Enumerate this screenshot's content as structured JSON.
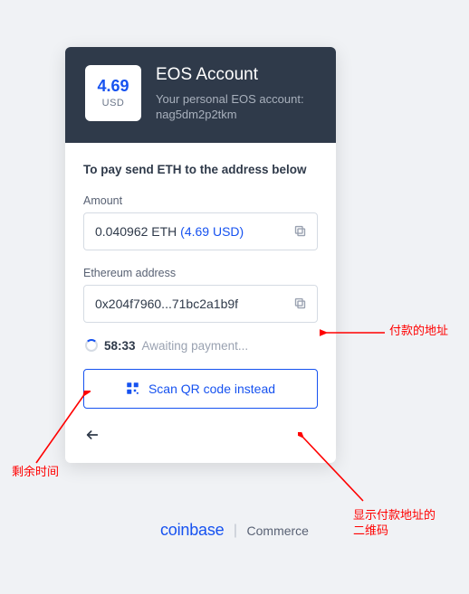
{
  "header": {
    "price": "4.69",
    "currency": "USD",
    "title": "EOS Account",
    "subtitle_prefix": "Your personal EOS account: ",
    "account": "nag5dm2p2tkm"
  },
  "instruction": "To pay send ETH to the address below",
  "amount": {
    "label": "Amount",
    "value": "0.040962 ETH ",
    "usd_value": "(4.69 USD)"
  },
  "address": {
    "label": "Ethereum address",
    "value": "0x204f7960...71bc2a1b9f"
  },
  "status": {
    "timer": "58:33",
    "text": "Awaiting payment..."
  },
  "qr_button": "Scan QR code instead",
  "footer": {
    "brand": "coinbase",
    "separator": "|",
    "sub": "Commerce"
  },
  "annotations": {
    "address_label": "付款的地址",
    "timer_label": "剩余时间",
    "qr_label": "显示付款地址的\n二维码"
  }
}
